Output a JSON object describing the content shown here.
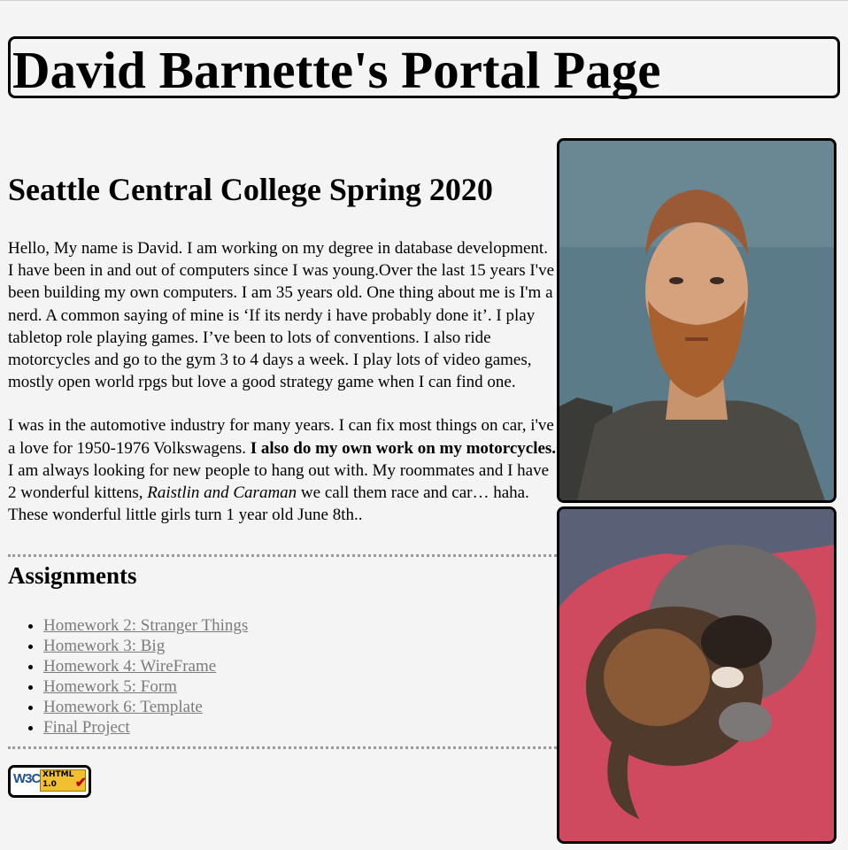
{
  "header": {
    "title": "David Barnette's Portal Page"
  },
  "main": {
    "heading": "Seattle Central College Spring 2020",
    "paragraph1": "Hello, My name is David. I am working on my degree in database development. I have been in and out of computers since I was young.Over the last 15 years I've been building my own computers. I am 35 years old. One thing about me is I'm a nerd. A common saying of mine is ‘If its nerdy i have probably done it’. I play tabletop role playing games. I’ve been to lots of conventions. I also ride motorcycles and go to the gym 3 to 4 days a week. I play lots of video games, mostly open world rpgs but love a good strategy game when I can find one.",
    "paragraph2_part1": "I was in the automotive industry for many years. I can fix most things on car, i've a love for 1950-1976 Volkswagens. ",
    "paragraph2_bold": "I also do my own work on my motorcycles.",
    "paragraph2_part2": " I am always looking for new people to hang out with. My roommates and I have 2 wonderful kittens, ",
    "paragraph2_italic": "Raistlin and Caraman",
    "paragraph2_part3": " we call them race and car… haha. These wonderful little girls turn 1 year old June 8th.."
  },
  "assignments": {
    "heading": "Assignments",
    "items": [
      "Homework 2: Stranger Things",
      "Homework 3: Big",
      "Homework 4: WireFrame",
      "Homework 5: Form",
      "Homework 6: Template",
      "Final Project"
    ]
  },
  "footer": {
    "badge_w3": "W3C",
    "badge_line1": "XHTML",
    "badge_line2": "1.0"
  },
  "colors": {
    "background": "#f4f4f4",
    "link": "#7b7b7b",
    "border": "#000000"
  }
}
